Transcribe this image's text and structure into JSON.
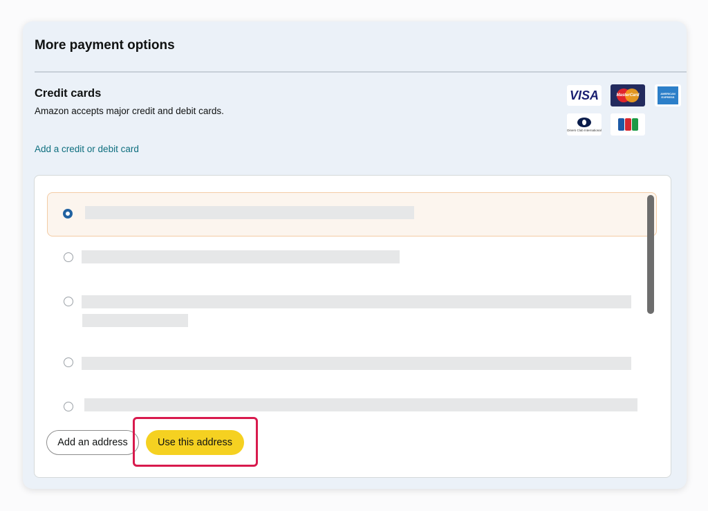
{
  "header": {
    "title": "More payment options"
  },
  "credit_cards": {
    "title": "Credit cards",
    "subtitle": "Amazon accepts major credit and debit cards.",
    "add_link": "Add a credit or debit card",
    "logos": {
      "visa": "VISA",
      "mastercard": "MasterCard",
      "amex": "AMERICAN EXPRESS",
      "diners": "Diners Club International",
      "jcb": "JCB"
    }
  },
  "addresses": {
    "options_count": 5,
    "selected_index": 0
  },
  "buttons": {
    "add_address": "Add an address",
    "use_address": "Use this address"
  },
  "colors": {
    "panel_bg": "#ebf1f8",
    "link": "#0d6e7e",
    "primary_button": "#f5d121",
    "selected_row_bg": "#fcf5ee",
    "highlight_outline": "#d81a4d",
    "radio_selected": "#2162a1"
  }
}
